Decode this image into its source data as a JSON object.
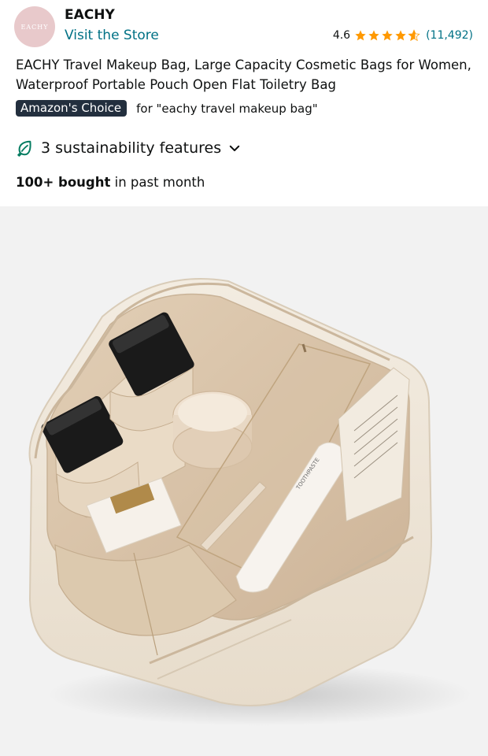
{
  "seller": {
    "logo_text": "EACHY",
    "name": "EACHY",
    "visit_link": "Visit the Store"
  },
  "rating": {
    "value": "4.6",
    "stars": 4.6,
    "review_count": "(11,492)",
    "star_color": "#ff9900"
  },
  "product": {
    "title": "EACHY Travel Makeup Bag, Large Capacity Cosmetic Bags for Women, Waterproof Portable Pouch Open Flat Toiletry Bag"
  },
  "badge": {
    "label": "Amazon's Choice",
    "query": "for \"eachy travel makeup bag\""
  },
  "sustainability": {
    "label": "3 sustainability features",
    "icon": "leaf-icon",
    "accent": "#067d62"
  },
  "bought": {
    "count": "100+ bought",
    "suffix": " in past month"
  },
  "product_image": {
    "alt": "Cream-colored open travel makeup bag with compartments",
    "jar_label": "",
    "tube_label": "TOOTHPASTE"
  },
  "colors": {
    "link": "#007185",
    "badge_bg": "#232f3e",
    "image_bg": "#f2f2f2",
    "bag": "#efe6d8"
  }
}
